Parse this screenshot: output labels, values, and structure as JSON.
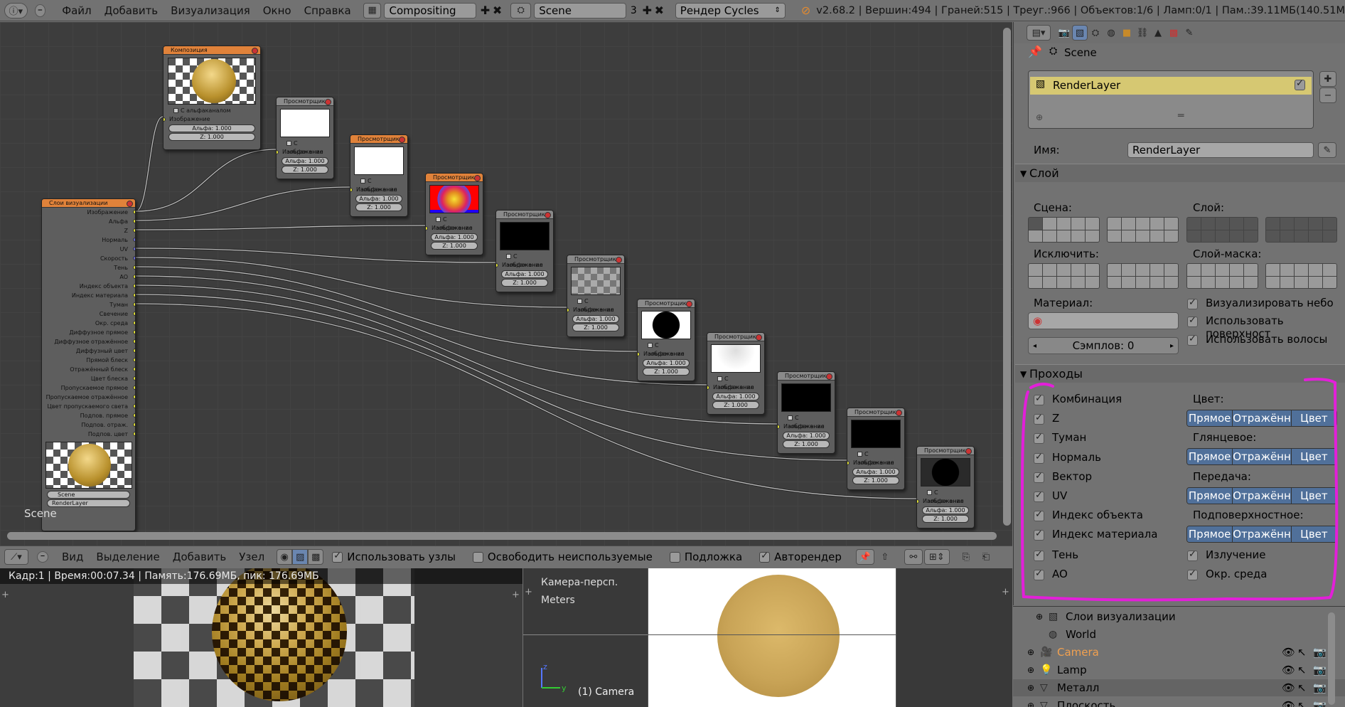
{
  "topbar": {
    "menus": [
      "Файл",
      "Добавить",
      "Визуализация",
      "Окно",
      "Справка"
    ],
    "screen_layout": "Compositing",
    "scene": "Scene",
    "scene_users": "3",
    "render_engine": "Рендер Cycles",
    "stats": "v2.68.2 | Вершин:494 | Граней:515 | Треуг.:966 | Объектов:1/6 | Ламп:0/1 | Пам.:39.11MБ(140.51M"
  },
  "node_editor": {
    "corner_label": "Scene",
    "render_layers_node": {
      "title": "Слои визуализации",
      "outputs": [
        "Изображение",
        "Альфа",
        "Z",
        "Нормаль",
        "UV",
        "Скорость",
        "Тень",
        "AO",
        "Индекс объекта",
        "Индекс материала",
        "Туман",
        "Свечение",
        "Окр. среда",
        "Диффузное прямое",
        "Диффузное отражённое",
        "Диффузный цвет",
        "Прямой блеск",
        "Отражённый блеск",
        "Цвет блеска",
        "Пропускаемое прямое",
        "Пропускаемое отражённое",
        "Цвет пропускаемого света",
        "Подпов. прямое",
        "Подпов. отраж.",
        "Подпов. цвет"
      ],
      "scene": "Scene",
      "layer": "RenderLayer"
    },
    "composite_node": {
      "title": "Композиция",
      "alpha_checkbox": "С альфаканалом",
      "input": "Изображение",
      "alpha": "Альфа: 1.000",
      "z": "Z: 1.000"
    },
    "viewer_node": {
      "title": "Просмотрщик",
      "alpha_checkbox": "С альфаканал",
      "input": "Изображение",
      "alpha": "Альфа: 1.000",
      "z": "Z: 1.000"
    }
  },
  "node_header": {
    "menus": [
      "Вид",
      "Выделение",
      "Добавить",
      "Узел"
    ],
    "use_nodes": "Использовать узлы",
    "free_unused": "Освободить неиспользуемые",
    "backdrop": "Подложка",
    "auto_render": "Авторендер"
  },
  "image_editor": {
    "info": "Кадр:1 | Время:00:07.34 | Память:176.69МБ, пик: 176.69МБ"
  },
  "viewport": {
    "view_name": "Камера-персп.",
    "units": "Meters",
    "object_label": "(1) Camera"
  },
  "properties": {
    "scene": "Scene",
    "layer_list": [
      "RenderLayer"
    ],
    "name_label": "Имя:",
    "name_value": "RenderLayer",
    "panel_layer": {
      "title": "Слой",
      "scene_label": "Сцена:",
      "layer_label": "Слой:",
      "exclude_label": "Исключить:",
      "mask_label": "Слой-маска:",
      "material_label": "Материал:",
      "samples": "Сэмплов: 0",
      "use_sky": "Визуализировать небо",
      "use_surfaces": "Использовать поверхност",
      "use_hair": "Использовать волосы"
    },
    "panel_passes": {
      "title": "Проходы",
      "left": [
        "Комбинация",
        "Z",
        "Туман",
        "Нормаль",
        "Вектор",
        "UV",
        "Индекс объекта",
        "Индекс материала"
      ],
      "color_labels": [
        "Цвет:",
        "Глянцевое:",
        "Передача:",
        "Подповерхностное:"
      ],
      "segment": [
        "Прямое",
        "Отражённ",
        "Цвет"
      ],
      "shadow": "Тень",
      "ao": "AO",
      "emit": "Излучение",
      "env": "Окр. среда"
    }
  },
  "outliner": {
    "rows": [
      "Слои визуализации",
      "World",
      "Camera",
      "Lamp",
      "Металл",
      "Плоскость"
    ]
  },
  "colors": {
    "accent": "#50709a",
    "highlight_marker": "#e31fd9",
    "node_header_active": "#e0823a",
    "selected_row": "#d6c872"
  }
}
